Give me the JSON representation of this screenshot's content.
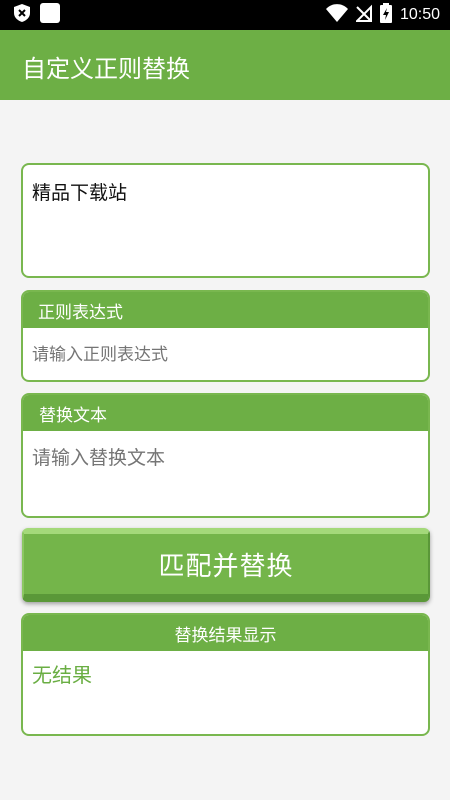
{
  "status_bar": {
    "time": "10:50",
    "icons": [
      "shield-close-icon",
      "app-square-icon",
      "wifi-icon",
      "no-signal-icon",
      "battery-charging-icon"
    ]
  },
  "app_bar": {
    "title": "自定义正则替换"
  },
  "source": {
    "text": "精品下载站"
  },
  "regex": {
    "header": "正则表达式",
    "placeholder": "请输入正则表达式",
    "value": ""
  },
  "replacement": {
    "header": "替换文本",
    "placeholder": "请输入替换文本",
    "value": ""
  },
  "action": {
    "label": "匹配并替换"
  },
  "result": {
    "header": "替换结果显示",
    "text": "无结果"
  },
  "colors": {
    "accent": "#6daf45",
    "border": "#79b74f",
    "placeholder": "#aab5c2",
    "result_text": "#6aae43"
  }
}
